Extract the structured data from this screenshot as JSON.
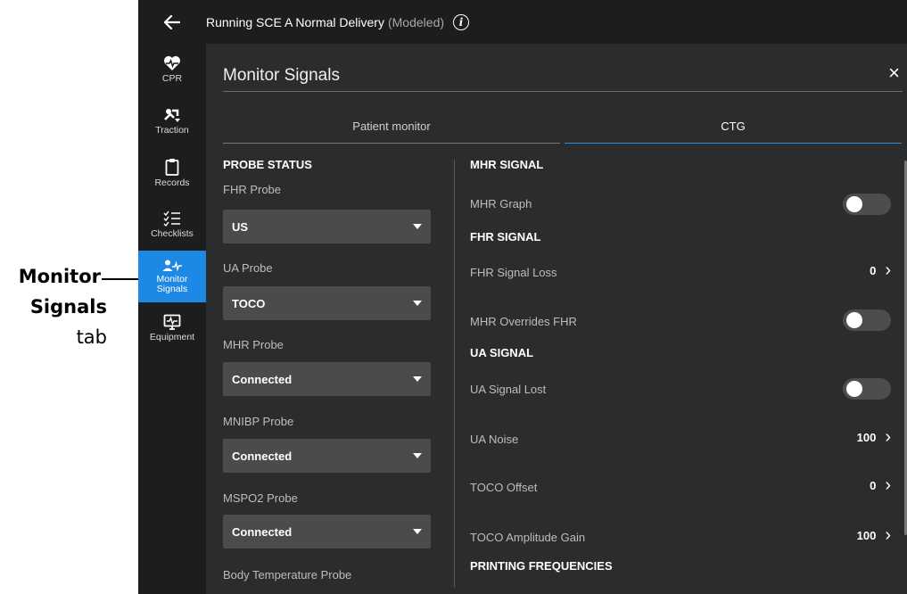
{
  "callout": {
    "line1": "Monitor",
    "line2": "Signals",
    "line3": "tab"
  },
  "topbar": {
    "back_icon": "arrow-left-icon",
    "title": "Running SCE  A Normal Delivery",
    "subtitle": "(Modeled)",
    "info_icon": "info-icon",
    "info_glyph": "i"
  },
  "sidebar": {
    "items": [
      {
        "label": "CPR",
        "icon": "heart-pulse-icon"
      },
      {
        "label": "Traction",
        "icon": "traction-icon"
      },
      {
        "label": "Records",
        "icon": "clipboard-icon"
      },
      {
        "label": "Checklists",
        "icon": "checklist-icon"
      },
      {
        "label": "Monitor Signals",
        "label_line1": "Monitor",
        "label_line2": "Signals",
        "icon": "monitor-signals-icon",
        "active": true
      },
      {
        "label": "Equipment",
        "icon": "equipment-monitor-icon"
      }
    ]
  },
  "panel": {
    "title": "Monitor Signals",
    "close_glyph": "×",
    "tabs": [
      {
        "label": "Patient monitor",
        "active": false
      },
      {
        "label": "CTG",
        "active": true
      }
    ]
  },
  "probe_status": {
    "heading": "PROBE STATUS",
    "probes": [
      {
        "label": "FHR Probe",
        "value": "US"
      },
      {
        "label": "UA Probe",
        "value": "TOCO"
      },
      {
        "label": "MHR Probe",
        "value": "Connected"
      },
      {
        "label": "MNIBP Probe",
        "value": "Connected"
      },
      {
        "label": "MSPO2 Probe",
        "value": "Connected"
      },
      {
        "label": "Body Temperature Probe",
        "value": ""
      }
    ]
  },
  "signals": {
    "mhr_heading": "MHR SIGNAL",
    "mhr_graph": {
      "label": "MHR Graph",
      "on": false
    },
    "fhr_heading": "FHR SIGNAL",
    "fhr_signal_loss": {
      "label": "FHR Signal Loss",
      "value": "0"
    },
    "mhr_overrides": {
      "label": "MHR Overrides FHR",
      "on": false
    },
    "ua_heading": "UA SIGNAL",
    "ua_signal_lost": {
      "label": "UA Signal Lost",
      "on": false
    },
    "ua_noise": {
      "label": "UA Noise",
      "value": "100"
    },
    "toco_offset": {
      "label": "TOCO Offset",
      "value": "0"
    },
    "toco_gain": {
      "label": "TOCO Amplitude Gain",
      "value": "100"
    },
    "printing_heading": "PRINTING FREQUENCIES",
    "chevron_glyph": "›"
  },
  "colors": {
    "accent": "#1e88e5",
    "background": "#2b2c2d",
    "sidebar": "#1c1d1e"
  }
}
